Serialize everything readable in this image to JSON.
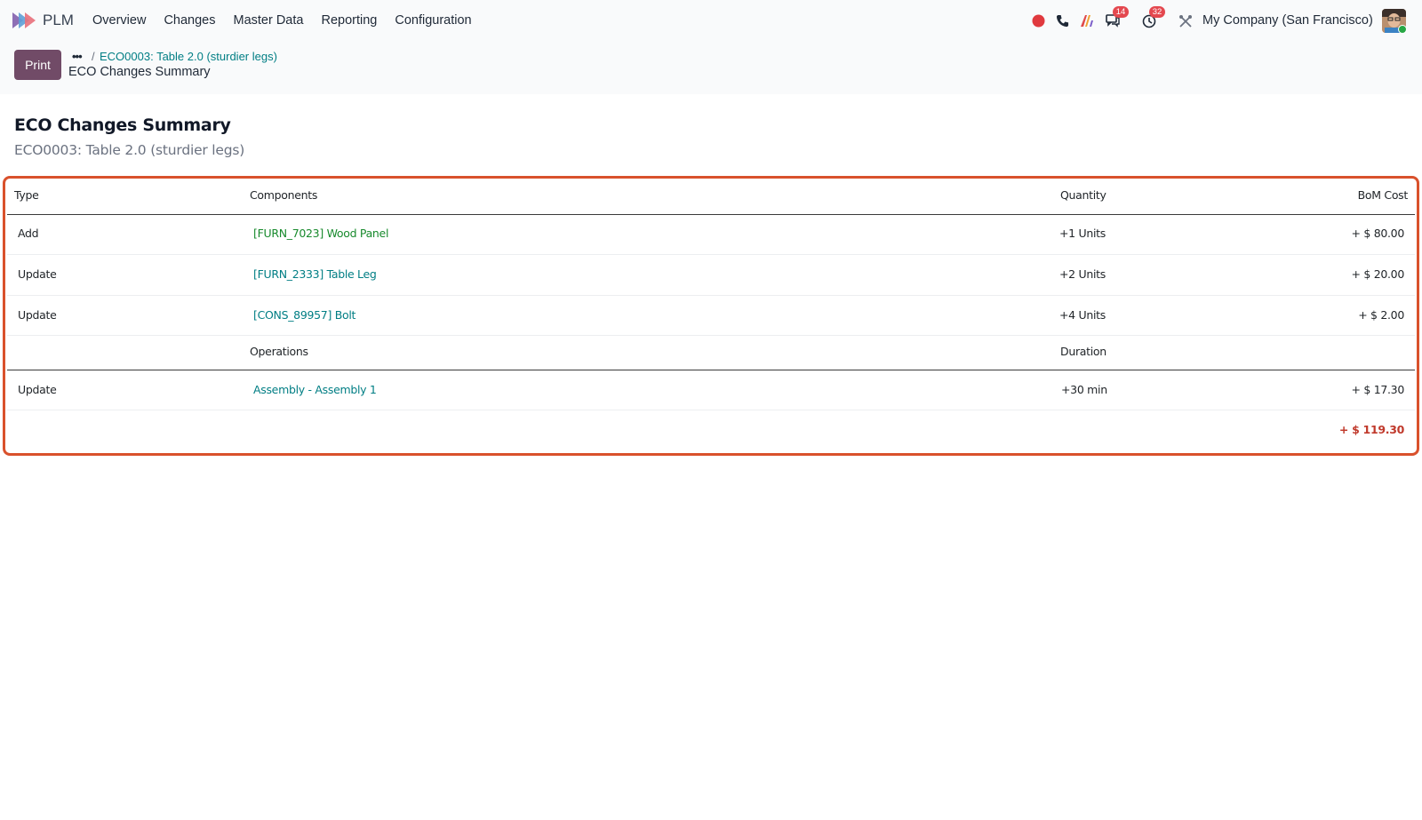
{
  "navbar": {
    "app_name": "PLM",
    "menu": [
      "Overview",
      "Changes",
      "Master Data",
      "Reporting",
      "Configuration"
    ],
    "discuss_badge": "14",
    "activity_badge": "32",
    "company": "My Company (San Francisco)"
  },
  "control": {
    "print_label": "Print",
    "breadcrumb_dots": "•••",
    "breadcrumb_sep": "/",
    "breadcrumb_parent": "ECO0003: Table 2.0 (sturdier legs)",
    "breadcrumb_current": "ECO Changes Summary"
  },
  "report": {
    "title": "ECO Changes Summary",
    "subtitle": "ECO0003: Table 2.0 (sturdier legs)",
    "headers": {
      "type": "Type",
      "components": "Components",
      "quantity": "Quantity",
      "bom_cost": "BoM Cost"
    },
    "component_rows": [
      {
        "type": "Add",
        "component": "[FURN_7023] Wood Panel",
        "quantity": "+1 Units",
        "cost": "+ $ 80.00"
      },
      {
        "type": "Update",
        "component": "[FURN_2333] Table Leg",
        "quantity": "+2 Units",
        "cost": "+ $ 20.00"
      },
      {
        "type": "Update",
        "component": "[CONS_89957] Bolt",
        "quantity": "+4 Units",
        "cost": "+ $ 2.00"
      }
    ],
    "operations_headers": {
      "operations": "Operations",
      "duration": "Duration"
    },
    "operation_rows": [
      {
        "type": "Update",
        "operation": "Assembly - Assembly 1",
        "duration": "+30 min",
        "cost": "+ $ 17.30"
      }
    ],
    "total": "+ $ 119.30"
  },
  "colors": {
    "brand": "#714b67",
    "highlight_border": "#d9512c",
    "link_green": "#188a2d",
    "link_teal": "#017e84",
    "total_red": "#c0392b"
  }
}
